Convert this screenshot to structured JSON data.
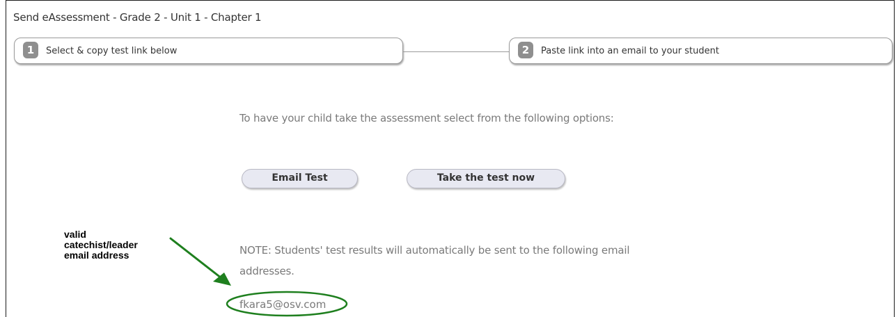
{
  "window": {
    "title": "Send eAssessment - Grade 2 - Unit 1 - Chapter 1"
  },
  "steps": [
    {
      "number": "1",
      "label": "Select & copy test link below"
    },
    {
      "number": "2",
      "label": "Paste link into an email to your student"
    }
  ],
  "main": {
    "instructions": "To have your child take the assessment select from the following options:",
    "buttons": {
      "email_test": "Email Test",
      "take_test": "Take the test now"
    },
    "note": "NOTE: Students' test results will automatically be sent to the following email addresses.",
    "email": "fkara5@osv.com"
  },
  "annotation": {
    "text_lines": [
      "valid",
      "catechist/leader",
      "email address"
    ],
    "arrow_color": "#1e7f1e",
    "ellipse_color": "#1e7f1e"
  }
}
